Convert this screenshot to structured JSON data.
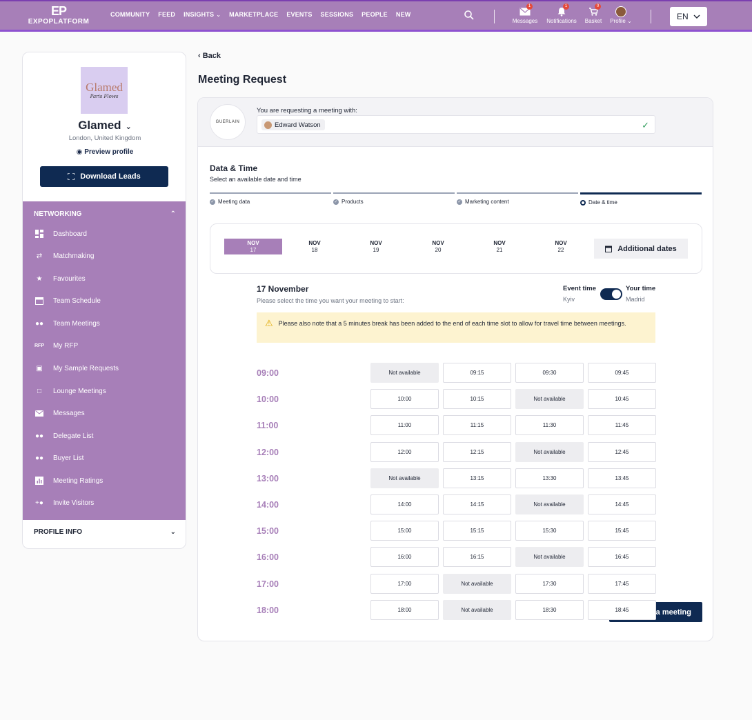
{
  "nav": {
    "logo_mark": "EP",
    "logo_text": "EXPOPLATFORM",
    "links": [
      "COMMUNITY",
      "FEED",
      "INSIGHTS",
      "MARKETPLACE",
      "EVENTS",
      "SESSIONS",
      "PEOPLE",
      "NEW"
    ],
    "icons": [
      {
        "label": "Messages",
        "badge": "1",
        "icon": "envelope-icon"
      },
      {
        "label": "Notifications",
        "badge": "1",
        "icon": "bell-icon"
      },
      {
        "label": "Basket",
        "badge": "0",
        "icon": "cart-icon"
      },
      {
        "label": "Profile",
        "icon": "avatar"
      }
    ],
    "language": "EN"
  },
  "sidebar": {
    "company_logo_text": "Glamed",
    "company_logo_script": "Paris Flows",
    "company_name": "Glamed",
    "location": "London, United Kingdom",
    "preview_label": "Preview profile",
    "download_label": "Download Leads",
    "section_label": "NETWORKING",
    "items": [
      {
        "label": "Dashboard",
        "icon": "dashboard-icon"
      },
      {
        "label": "Matchmaking",
        "icon": "matchmaking-icon"
      },
      {
        "label": "Favourites",
        "icon": "star-icon"
      },
      {
        "label": "Team Schedule",
        "icon": "calendar-icon"
      },
      {
        "label": "Team Meetings",
        "icon": "team-meetings-icon"
      },
      {
        "label": "My RFP",
        "icon": "rfp-icon"
      },
      {
        "label": "My Sample Requests",
        "icon": "sample-requests-icon"
      },
      {
        "label": "Lounge Meetings",
        "icon": "lounge-icon"
      },
      {
        "label": "Messages",
        "icon": "envelope-icon"
      },
      {
        "label": "Delegate List",
        "icon": "people-icon"
      },
      {
        "label": "Buyer List",
        "icon": "people-icon"
      },
      {
        "label": "Meeting Ratings",
        "icon": "bar-chart-icon"
      },
      {
        "label": "Invite Visitors",
        "icon": "invite-icon"
      }
    ],
    "profile_info_label": "PROFILE INFO"
  },
  "main": {
    "back_label": "Back",
    "title": "Meeting Request",
    "brand_logo_text": "GUERLAIN",
    "requesting_label": "You are requesting a meeting with:",
    "attendee": "Edward Watson",
    "section_title": "Data & Time",
    "section_sub": "Select an available date and time",
    "steps": [
      "Meeting data",
      "Products",
      "Marketing content",
      "Date & time"
    ],
    "dates": [
      {
        "month": "NOV",
        "day": "17",
        "selected": true
      },
      {
        "month": "NOV",
        "day": "18"
      },
      {
        "month": "NOV",
        "day": "19"
      },
      {
        "month": "NOV",
        "day": "20"
      },
      {
        "month": "NOV",
        "day": "21"
      },
      {
        "month": "NOV",
        "day": "22"
      }
    ],
    "additional_dates_label": "Additional dates",
    "day_title": "17 November",
    "day_sub": "Please select the time you want your meeting to start:",
    "event_time_label": "Event time",
    "event_time_city": "Kyiv",
    "your_time_label": "Your time",
    "your_time_city": "Madrid",
    "notice": "Please also note that a 5 minutes break has been added to the end of each time slot to allow for travel time between meetings.",
    "slots": [
      {
        "hour": "09:00",
        "times": [
          "Not available",
          "09:15",
          "09:30",
          "09:45"
        ]
      },
      {
        "hour": "10:00",
        "times": [
          "10:00",
          "10:15",
          "Not available",
          "10:45"
        ]
      },
      {
        "hour": "11:00",
        "times": [
          "11:00",
          "11:15",
          "11:30",
          "11:45"
        ]
      },
      {
        "hour": "12:00",
        "times": [
          "12:00",
          "12:15",
          "Not available",
          "12:45"
        ]
      },
      {
        "hour": "13:00",
        "times": [
          "Not available",
          "13:15",
          "13:30",
          "13:45"
        ]
      },
      {
        "hour": "14:00",
        "times": [
          "14:00",
          "14:15",
          "Not available",
          "14:45"
        ]
      },
      {
        "hour": "15:00",
        "times": [
          "15:00",
          "15:15",
          "15:30",
          "15:45"
        ]
      },
      {
        "hour": "16:00",
        "times": [
          "16:00",
          "16:15",
          "Not available",
          "16:45"
        ]
      },
      {
        "hour": "17:00",
        "times": [
          "17:00",
          "Not available",
          "17:30",
          "17:45"
        ]
      },
      {
        "hour": "18:00",
        "times": [
          "18:00",
          "Not available",
          "18:30",
          "18:45"
        ]
      }
    ],
    "send_label": "a meeting"
  },
  "colors": {
    "accent_purple": "#a77fb8",
    "navy": "#0f2a52",
    "notice_bg": "#fdf3d0"
  }
}
